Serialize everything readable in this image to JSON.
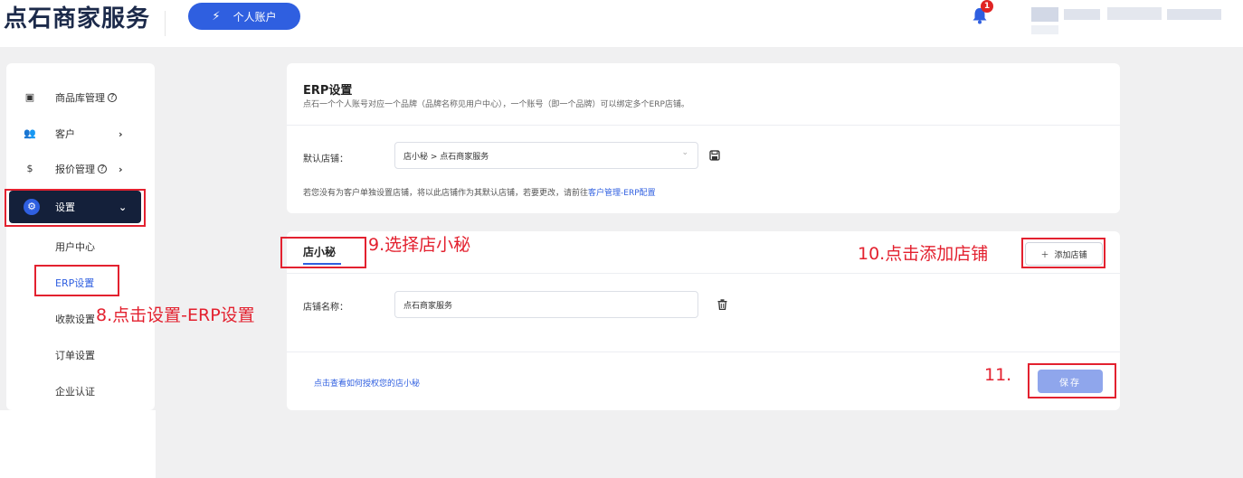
{
  "header": {
    "logo": "点石商家服务",
    "account_button": "个人账户",
    "notification_count": "1"
  },
  "sidebar": {
    "items": [
      {
        "label": "商品库管理",
        "help": "?",
        "icon": "box-icon"
      },
      {
        "label": "客户",
        "arrow": ">",
        "icon": "users-icon"
      },
      {
        "label": "报价管理",
        "help": "?",
        "arrow": ">",
        "icon": "price-tag-icon"
      },
      {
        "label": "设置",
        "arrow": "v",
        "icon": "gear-icon"
      }
    ],
    "sub_items": [
      {
        "label": "用户中心"
      },
      {
        "label": "ERP设置"
      },
      {
        "label": "收款设置"
      },
      {
        "label": "订单设置"
      },
      {
        "label": "企业认证"
      }
    ]
  },
  "erp_card": {
    "title": "ERP设置",
    "description": "点石一个个人账号对应一个品牌（品牌名称见用户中心），一个账号（即一个品牌）可以绑定多个ERP店铺。",
    "default_store_label": "默认店铺：",
    "default_store_value": "店小秘 > 点石商家服务",
    "hint_prefix": "若您没有为客户单独设置店铺，将以此店铺作为其默认店铺，若要更改，请前往",
    "hint_link": "客户管理-ERP配置"
  },
  "store_card": {
    "tab_label": "店小秘",
    "add_store_button": "添加店铺",
    "store_name_label": "店铺名称：",
    "store_name_value": "点石商家服务",
    "auth_link": "点击查看如何授权您的店小秘",
    "save_button": "保存"
  },
  "annotations": {
    "step8": "8.点击设置-ERP设置",
    "step9": "9.选择店小秘",
    "step10": "10.点击添加店铺",
    "step11": "11."
  },
  "colors": {
    "accent": "#2f5fe0",
    "annotation_red": "#e3212f",
    "nav_active_bg": "#14203a",
    "save_disabled": "#8fa6ec"
  }
}
